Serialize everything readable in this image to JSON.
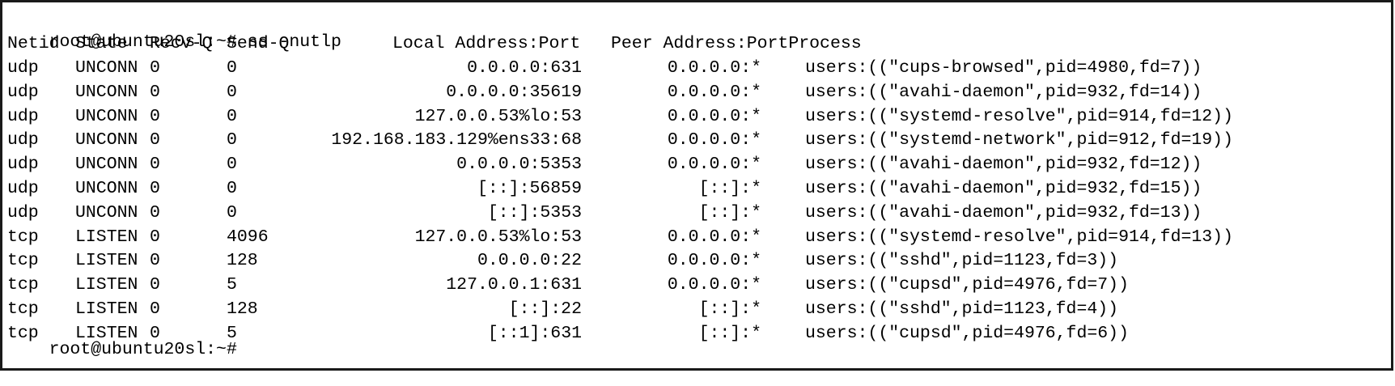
{
  "prompt": {
    "command_line": "root@ubuntu20sl:~# ss -nutlp",
    "final_prompt": "root@ubuntu20sl:~#"
  },
  "table": {
    "headers": {
      "netid": "Netid",
      "state": "State",
      "recvq": "Recv-Q",
      "sendq": "Send-Q",
      "local": "Local Address:Port",
      "peer_process": "Peer Address:PortProcess"
    },
    "rows": [
      {
        "netid": "udp",
        "state": "UNCONN",
        "recvq": "0",
        "sendq": "0",
        "local": "0.0.0.0:631",
        "peer": "0.0.0.0:*",
        "process": "users:((\"cups-browsed\",pid=4980,fd=7))"
      },
      {
        "netid": "udp",
        "state": "UNCONN",
        "recvq": "0",
        "sendq": "0",
        "local": "0.0.0.0:35619",
        "peer": "0.0.0.0:*",
        "process": "users:((\"avahi-daemon\",pid=932,fd=14))"
      },
      {
        "netid": "udp",
        "state": "UNCONN",
        "recvq": "0",
        "sendq": "0",
        "local": "127.0.0.53%lo:53",
        "peer": "0.0.0.0:*",
        "process": "users:((\"systemd-resolve\",pid=914,fd=12))"
      },
      {
        "netid": "udp",
        "state": "UNCONN",
        "recvq": "0",
        "sendq": "0",
        "local": "192.168.183.129%ens33:68",
        "peer": "0.0.0.0:*",
        "process": "users:((\"systemd-network\",pid=912,fd=19))"
      },
      {
        "netid": "udp",
        "state": "UNCONN",
        "recvq": "0",
        "sendq": "0",
        "local": "0.0.0.0:5353",
        "peer": "0.0.0.0:*",
        "process": "users:((\"avahi-daemon\",pid=932,fd=12))"
      },
      {
        "netid": "udp",
        "state": "UNCONN",
        "recvq": "0",
        "sendq": "0",
        "local": "[::]:56859",
        "peer": "[::]:*",
        "process": "users:((\"avahi-daemon\",pid=932,fd=15))"
      },
      {
        "netid": "udp",
        "state": "UNCONN",
        "recvq": "0",
        "sendq": "0",
        "local": "[::]:5353",
        "peer": "[::]:*",
        "process": "users:((\"avahi-daemon\",pid=932,fd=13))"
      },
      {
        "netid": "tcp",
        "state": "LISTEN",
        "recvq": "0",
        "sendq": "4096",
        "local": "127.0.0.53%lo:53",
        "peer": "0.0.0.0:*",
        "process": "users:((\"systemd-resolve\",pid=914,fd=13))"
      },
      {
        "netid": "tcp",
        "state": "LISTEN",
        "recvq": "0",
        "sendq": "128",
        "local": "0.0.0.0:22",
        "peer": "0.0.0.0:*",
        "process": "users:((\"sshd\",pid=1123,fd=3))"
      },
      {
        "netid": "tcp",
        "state": "LISTEN",
        "recvq": "0",
        "sendq": "5",
        "local": "127.0.0.1:631",
        "peer": "0.0.0.0:*",
        "process": "users:((\"cupsd\",pid=4976,fd=7))"
      },
      {
        "netid": "tcp",
        "state": "LISTEN",
        "recvq": "0",
        "sendq": "128",
        "local": "[::]:22",
        "peer": "[::]:*",
        "process": "users:((\"sshd\",pid=1123,fd=4))"
      },
      {
        "netid": "tcp",
        "state": "LISTEN",
        "recvq": "0",
        "sendq": "5",
        "local": "[::1]:631",
        "peer": "[::]:*",
        "process": "users:((\"cupsd\",pid=4976,fd=6))"
      }
    ]
  }
}
